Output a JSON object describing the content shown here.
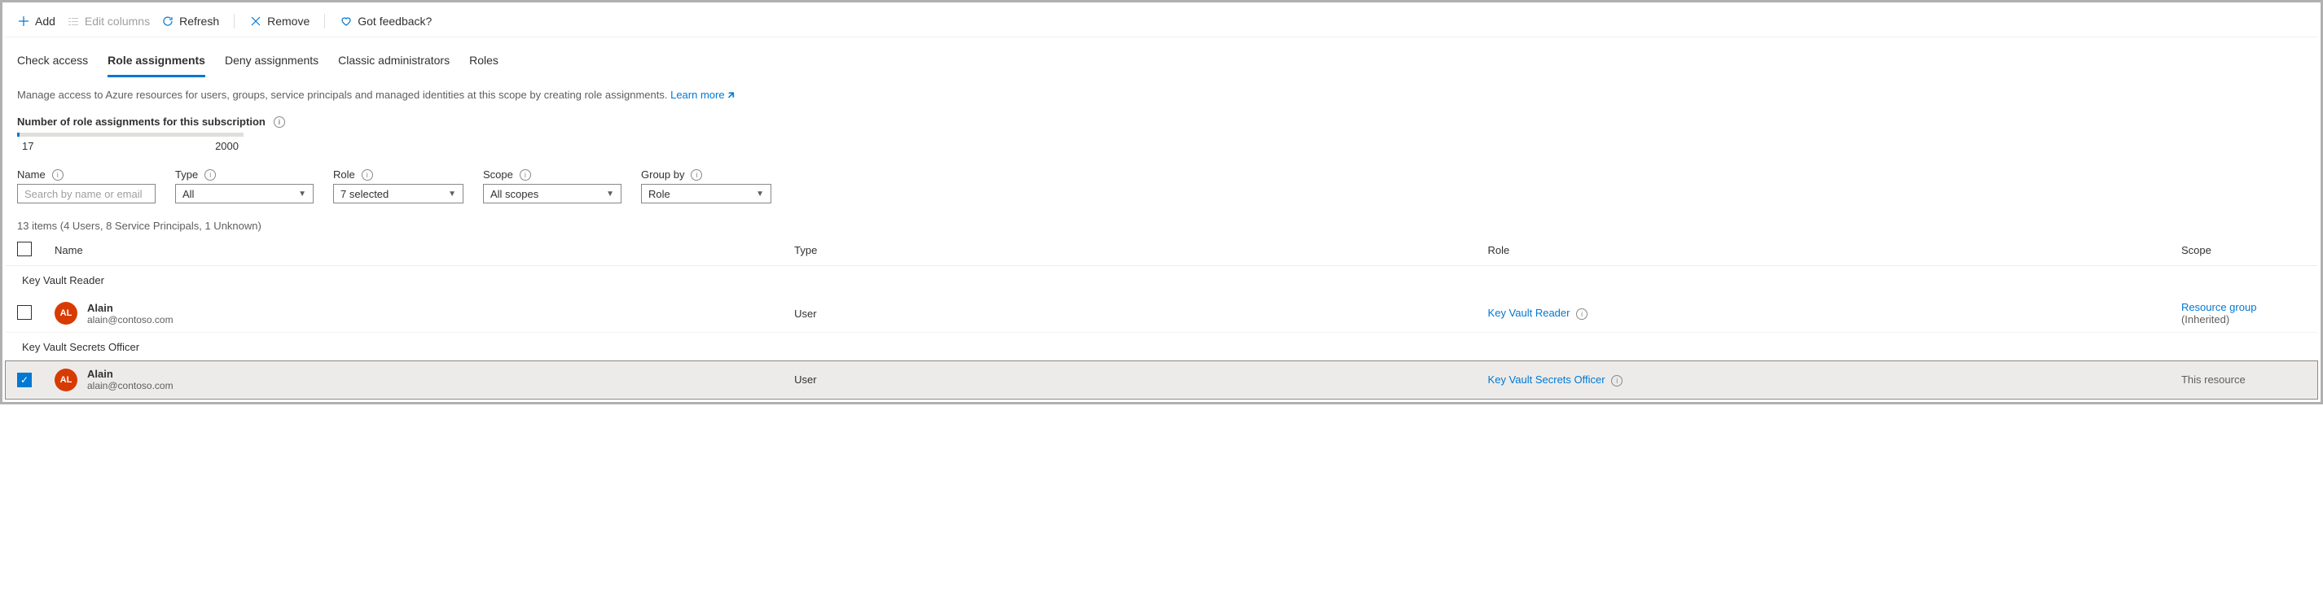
{
  "toolbar": {
    "add": "Add",
    "edit_columns": "Edit columns",
    "refresh": "Refresh",
    "remove": "Remove",
    "feedback": "Got feedback?"
  },
  "tabs": {
    "check_access": "Check access",
    "role_assignments": "Role assignments",
    "deny_assignments": "Deny assignments",
    "classic_admins": "Classic administrators",
    "roles": "Roles"
  },
  "description": "Manage access to Azure resources for users, groups, service principals and managed identities at this scope by creating role assignments.",
  "learn_more": "Learn more",
  "quota": {
    "label": "Number of role assignments for this subscription",
    "current": "17",
    "max": "2000"
  },
  "filters": {
    "name_label": "Name",
    "name_placeholder": "Search by name or email",
    "type_label": "Type",
    "type_value": "All",
    "role_label": "Role",
    "role_value": "7 selected",
    "scope_label": "Scope",
    "scope_value": "All scopes",
    "groupby_label": "Group by",
    "groupby_value": "Role"
  },
  "items_count": "13 items (4 Users, 8 Service Principals, 1 Unknown)",
  "headers": {
    "name": "Name",
    "type": "Type",
    "role": "Role",
    "scope": "Scope"
  },
  "groups": [
    {
      "title": "Key Vault Reader",
      "rows": [
        {
          "selected": false,
          "initials": "AL",
          "name": "Alain",
          "email": "alain@contoso.com",
          "type": "User",
          "role": "Key Vault Reader",
          "scope_link": "Resource group",
          "scope_extra": "(Inherited)"
        }
      ]
    },
    {
      "title": "Key Vault Secrets Officer",
      "rows": [
        {
          "selected": true,
          "initials": "AL",
          "name": "Alain",
          "email": "alain@contoso.com",
          "type": "User",
          "role": "Key Vault Secrets Officer",
          "scope_text": "This resource"
        }
      ]
    }
  ]
}
